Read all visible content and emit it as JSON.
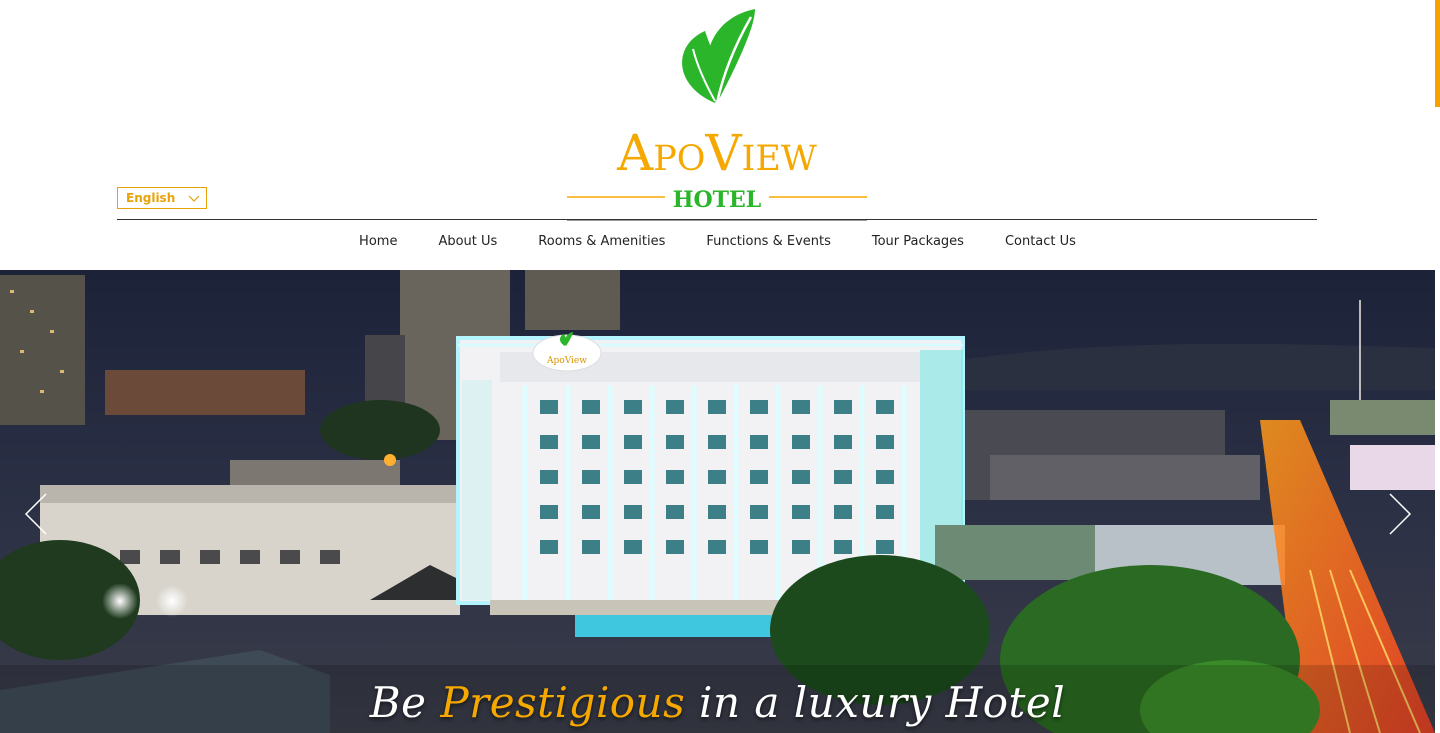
{
  "brand": {
    "name_line1": "ApoView",
    "name_line2": "HOTEL",
    "primary_color": "#f5a800",
    "leaf_color": "#2bb52a"
  },
  "language_selector": {
    "selected": "English"
  },
  "nav": {
    "items": [
      {
        "label": "Home"
      },
      {
        "label": "About Us"
      },
      {
        "label": "Rooms & Amenities"
      },
      {
        "label": "Functions & Events"
      },
      {
        "label": "Tour Packages"
      },
      {
        "label": "Contact Us"
      }
    ]
  },
  "hero": {
    "slogan_prefix": "Be",
    "slogan_highlight": "Prestigious",
    "slogan_suffix": "in a luxury Hotel",
    "building_sign": "ApoView"
  }
}
